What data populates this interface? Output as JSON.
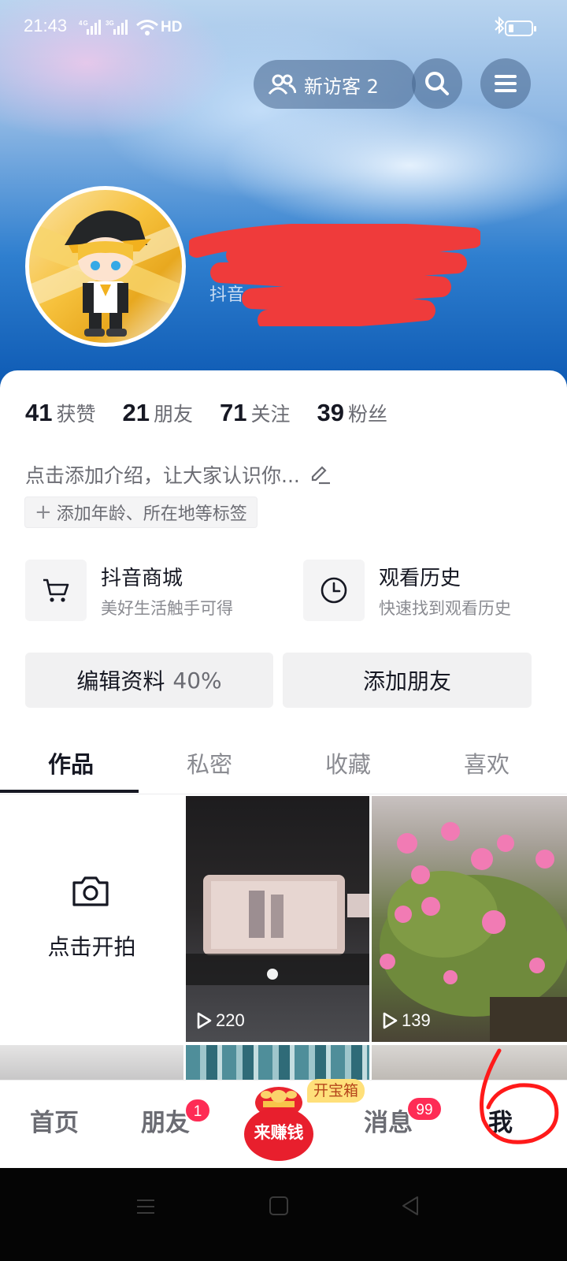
{
  "status_bar": {
    "time": "21:43",
    "network": "4G 3G",
    "wifi_label": "HD"
  },
  "header": {
    "visitors_label": "新访客",
    "visitors_count": "2",
    "handle_fragment": "抖音"
  },
  "stats": [
    {
      "num": "41",
      "label": "获赞"
    },
    {
      "num": "21",
      "label": "朋友"
    },
    {
      "num": "71",
      "label": "关注"
    },
    {
      "num": "39",
      "label": "粉丝"
    }
  ],
  "bio": {
    "text": "点击添加介绍，让大家认识你...",
    "tag_button": "添加年龄、所在地等标签"
  },
  "services": [
    {
      "title": "抖音商城",
      "subtitle": "美好生活触手可得",
      "icon": "cart-icon"
    },
    {
      "title": "观看历史",
      "subtitle": "快速找到观看历史",
      "icon": "clock-icon"
    }
  ],
  "buttons": {
    "edit_profile": "编辑资料",
    "edit_percent": "40%",
    "add_friends": "添加朋友"
  },
  "tabs": [
    "作品",
    "私密",
    "收藏",
    "喜欢"
  ],
  "active_tab": "作品",
  "grid": {
    "shoot_label": "点击开拍",
    "videos": [
      {
        "plays": "220"
      },
      {
        "plays": "139"
      }
    ]
  },
  "bottom_nav": {
    "home": "首页",
    "friends": "朋友",
    "friends_badge": "1",
    "earn": "来赚钱",
    "chest": "开宝箱",
    "messages": "消息",
    "messages_badge": "99",
    "me": "我"
  },
  "colors": {
    "accent": "#fe2c55",
    "text": "#161823",
    "secondary": "#6b6c73"
  }
}
